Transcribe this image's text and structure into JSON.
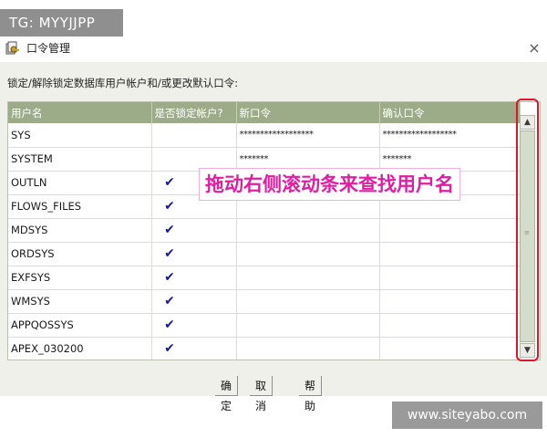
{
  "watermarks": {
    "top": "TG: MYYJJPP",
    "bottom": "www.siteyabo.com"
  },
  "window": {
    "title": "口令管理",
    "icon": "key-manager-icon",
    "close_label": "×"
  },
  "instruction": "锁定/解除锁定数据库用户帐户和/或更改默认口令:",
  "table": {
    "columns": [
      "用户名",
      "是否锁定帐户?",
      "新口令",
      "确认口令"
    ],
    "rows": [
      {
        "user": "SYS",
        "locked": "",
        "new_pw": "******************",
        "confirm_pw": "******************"
      },
      {
        "user": "SYSTEM",
        "locked": "",
        "new_pw": "*******",
        "confirm_pw": "*******"
      },
      {
        "user": "OUTLN",
        "locked": "✔",
        "new_pw": "",
        "confirm_pw": ""
      },
      {
        "user": "FLOWS_FILES",
        "locked": "✔",
        "new_pw": "",
        "confirm_pw": ""
      },
      {
        "user": "MDSYS",
        "locked": "✔",
        "new_pw": "",
        "confirm_pw": ""
      },
      {
        "user": "ORDSYS",
        "locked": "✔",
        "new_pw": "",
        "confirm_pw": ""
      },
      {
        "user": "EXFSYS",
        "locked": "✔",
        "new_pw": "",
        "confirm_pw": ""
      },
      {
        "user": "WMSYS",
        "locked": "✔",
        "new_pw": "",
        "confirm_pw": ""
      },
      {
        "user": "APPQOSSYS",
        "locked": "✔",
        "new_pw": "",
        "confirm_pw": ""
      },
      {
        "user": "APEX_030200",
        "locked": "✔",
        "new_pw": "",
        "confirm_pw": ""
      }
    ]
  },
  "scrollbar": {
    "up": "▲",
    "down": "▼"
  },
  "annotation": "拖动右侧滚动条来查找用户名",
  "buttons": {
    "ok": "确定",
    "cancel": "取消",
    "help": "帮助"
  },
  "colors": {
    "header_bg": "#9dac88",
    "check_mark": "#1a1aa0",
    "annotation_text": "#e01ea3",
    "highlight_border": "#e0142a"
  }
}
